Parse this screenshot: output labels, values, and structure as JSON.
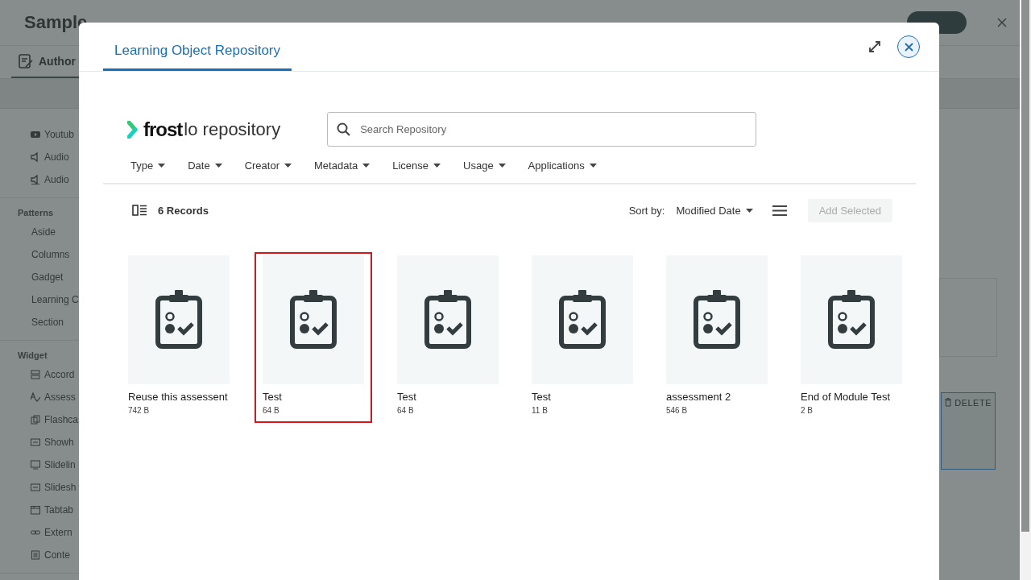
{
  "background_app": {
    "title": "Sample",
    "tabs": [
      {
        "label": "Author",
        "selected": true
      }
    ],
    "sidebar": [
      {
        "items": [
          {
            "label": "Youtub",
            "kind": "video"
          },
          {
            "label": "Audio",
            "kind": "audio"
          },
          {
            "label": "Audio",
            "kind": "audio-video"
          }
        ]
      },
      {
        "heading": "Patterns",
        "items": [
          {
            "label": "Aside",
            "kind": "plain"
          },
          {
            "label": "Columns",
            "kind": "plain"
          },
          {
            "label": "Gadget",
            "kind": "plain"
          },
          {
            "label": "Learning C",
            "kind": "plain"
          },
          {
            "label": "Section",
            "kind": "plain"
          }
        ]
      },
      {
        "heading": "Widget",
        "items": [
          {
            "label": "Accord",
            "kind": "accordion"
          },
          {
            "label": "Assess",
            "kind": "assessment"
          },
          {
            "label": "Flashca",
            "kind": "flashcard"
          },
          {
            "label": "Showh",
            "kind": "panel"
          },
          {
            "label": "Slidelin",
            "kind": "screen"
          },
          {
            "label": "Slidesh",
            "kind": "panel"
          },
          {
            "label": "Tabtab",
            "kind": "tabs"
          },
          {
            "label": "Extern",
            "kind": "link"
          },
          {
            "label": "Conte",
            "kind": "document"
          }
        ]
      }
    ],
    "delete_button": "DELETE"
  },
  "modal": {
    "tabs": [
      {
        "label": "Learning Object Repository",
        "selected": true
      }
    ],
    "logo": {
      "brand": "frost",
      "product": "lo repository"
    },
    "search": {
      "placeholder": "Search Repository"
    },
    "filters": [
      "Type",
      "Date",
      "Creator",
      "Metadata",
      "License",
      "Usage",
      "Applications"
    ],
    "records": "6 Records",
    "sort_label": "Sort by:",
    "sort_value": "Modified Date",
    "add_button": {
      "label": "Add Selected",
      "disabled": true
    },
    "items": [
      {
        "name": "Reuse this assessent",
        "size": "742 B",
        "selected": false
      },
      {
        "name": "Test",
        "size": "64 B",
        "selected": true
      },
      {
        "name": "Test",
        "size": "64 B",
        "selected": false
      },
      {
        "name": "Test",
        "size": "11 B",
        "selected": false
      },
      {
        "name": "assessment 2",
        "size": "546 B",
        "selected": false
      },
      {
        "name": "End of Module Test",
        "size": "2 B",
        "selected": false
      }
    ]
  }
}
